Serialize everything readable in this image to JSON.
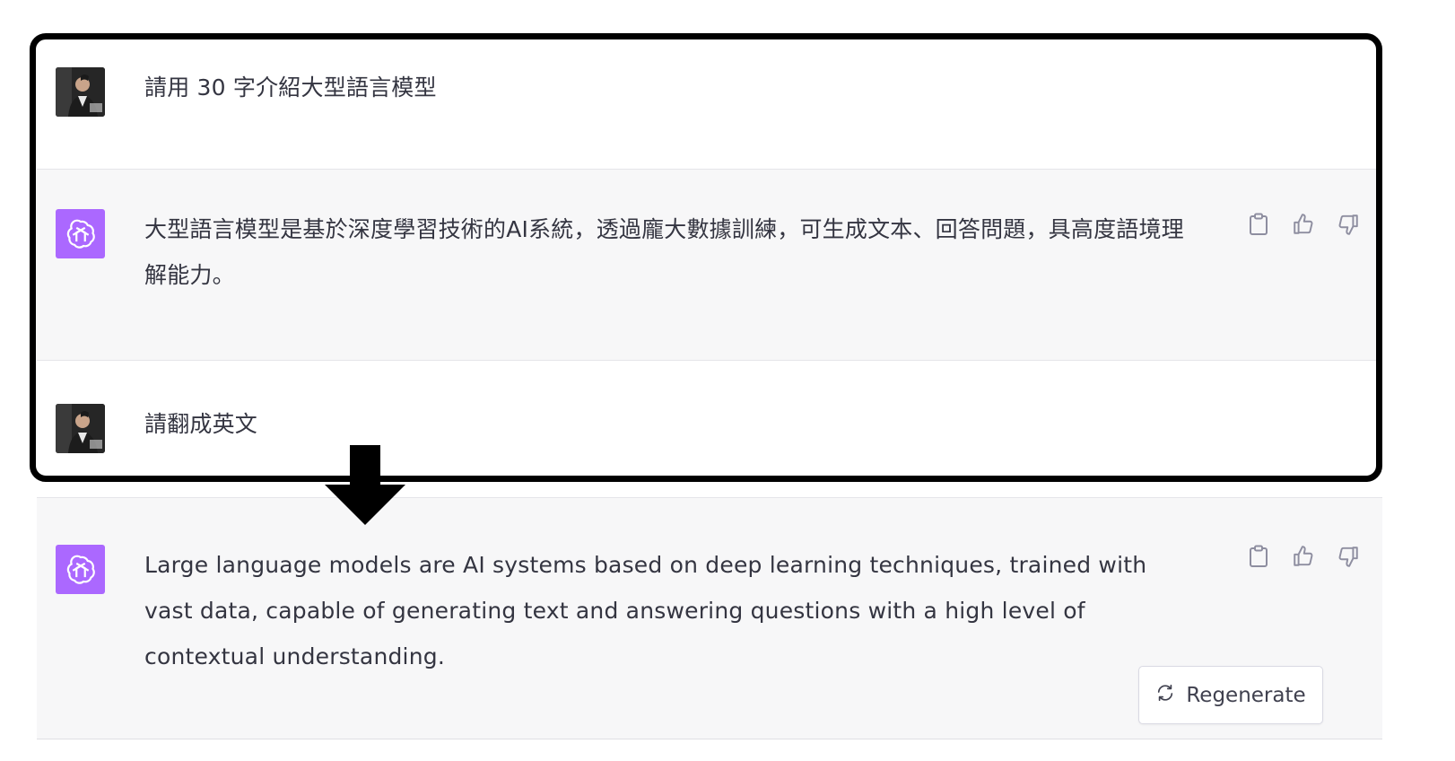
{
  "conversation": [
    {
      "role": "user",
      "text": "請用 30 字介紹大型語言模型",
      "avatar_icon": "user-photo-avatar"
    },
    {
      "role": "assistant",
      "text": "大型語言模型是基於深度學習技術的AI系統，透過龐大數據訓練，可生成文本、回答問題，具高度語境理解能力。",
      "avatar_icon": "openai-logo-icon",
      "actions": [
        "clipboard-icon",
        "thumbs-up-icon",
        "thumbs-down-icon"
      ]
    },
    {
      "role": "user",
      "text": "請翻成英文",
      "avatar_icon": "user-photo-avatar"
    },
    {
      "role": "assistant",
      "text": "Large language models are AI systems based on deep learning techniques, trained with vast data, capable of generating text and answering questions with a high level of contextual understanding.",
      "avatar_icon": "openai-logo-icon",
      "actions": [
        "clipboard-icon",
        "thumbs-up-icon",
        "thumbs-down-icon"
      ]
    }
  ],
  "regenerate": {
    "label": "Regenerate",
    "icon": "refresh-icon"
  },
  "colors": {
    "assistant_bg": "#f7f7f8",
    "assistant_avatar": "#ab68ff",
    "text": "#343541",
    "icon": "#8e8ea0",
    "annotation": "#000000"
  }
}
